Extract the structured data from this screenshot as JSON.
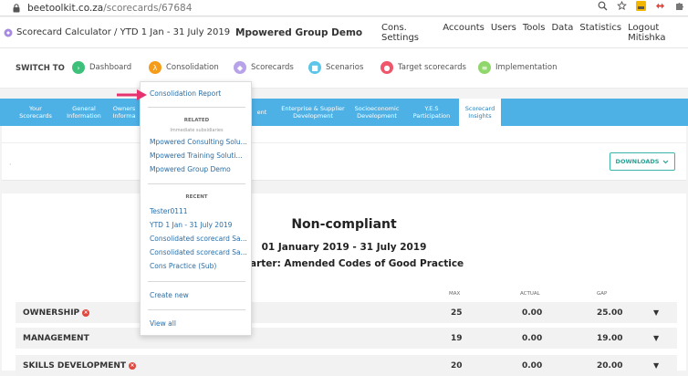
{
  "browser": {
    "url_host": "beetoolkit.co.za",
    "url_path": "/scorecards/67684"
  },
  "header": {
    "title": "Scorecard Calculator / YTD 1 Jan - 31 July 2019",
    "company": "Mpowered Group Demo",
    "menu": [
      "Cons. Settings",
      "Accounts",
      "Users",
      "Tools",
      "Data",
      "Statistics",
      "Logout Mitishka"
    ]
  },
  "switchbar": {
    "label": "SWITCH TO",
    "items": [
      "Dashboard",
      "Consolidation",
      "Scorecards",
      "Scenarios",
      "Target scorecards",
      "Implementation"
    ]
  },
  "tabs": [
    [
      "Your",
      "Scorecards"
    ],
    [
      "General",
      "Information"
    ],
    [
      "Owners",
      "Informa"
    ],
    [
      "",
      "ent"
    ],
    [
      "Enterprise & Supplier",
      "Development"
    ],
    [
      "Socioeconomic",
      "Development"
    ],
    [
      "Y.E.S",
      "Participation"
    ],
    [
      "Scorecard",
      "Insights"
    ]
  ],
  "downloads_label": "DOWNLOADS",
  "report": {
    "status": "Non-compliant",
    "period": "01 January 2019 - 31 July 2019",
    "charter": "arter: Amended Codes of Good Practice",
    "columns": [
      "MAX",
      "ACTUAL",
      "GAP"
    ],
    "rows": [
      {
        "name": "OWNERSHIP",
        "max": "25",
        "actual": "0.00",
        "gap": "25.00",
        "failed": true
      },
      {
        "name": "MANAGEMENT",
        "max": "19",
        "actual": "0.00",
        "gap": "19.00",
        "failed": false
      },
      {
        "name": "SKILLS DEVELOPMENT",
        "max": "20",
        "actual": "0.00",
        "gap": "20.00",
        "failed": true
      }
    ]
  },
  "dropdown": {
    "top_item": "Consolidation Report",
    "related_label": "RELATED",
    "related_sub": "Immediate subsidiaries",
    "related": [
      "Mpowered Consulting Solu...",
      "Mpowered Training Soluti...",
      "Mpowered Group Demo"
    ],
    "recent_label": "RECENT",
    "recent": [
      "Tester0111",
      "YTD 1 Jan - 31 July 2019",
      "Consolidated scorecard Sa...",
      "Consolidated scorecard Sa...",
      "Cons Practice (Sub)"
    ],
    "create_new": "Create new",
    "view_all": "View all"
  },
  "colors": {
    "tab_bar": "#4db1e6",
    "link": "#2b6ea6",
    "teal": "#2aa197",
    "arrow": "#e6336f",
    "danger": "#e0463d"
  }
}
